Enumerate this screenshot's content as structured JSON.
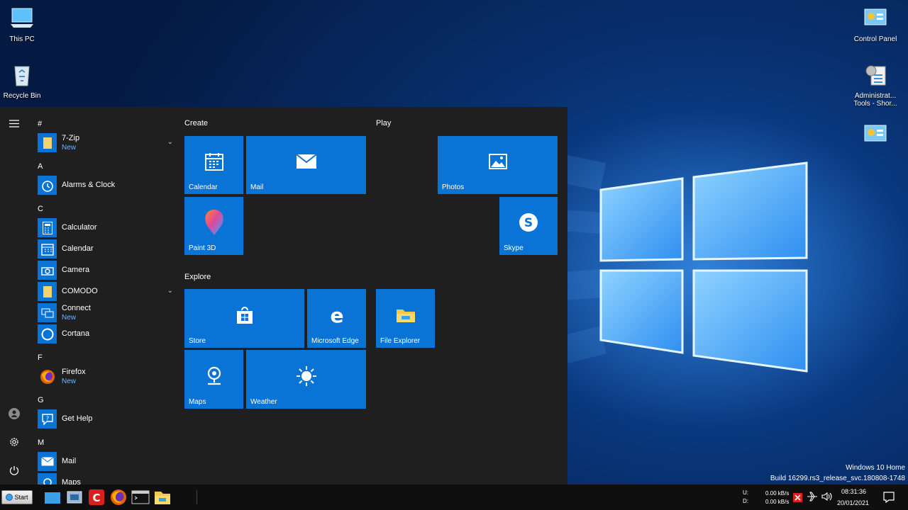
{
  "desktop": {
    "icons_left": [
      {
        "label": "This PC",
        "icon": "this-pc-icon"
      },
      {
        "label": "Recycle Bin",
        "icon": "recycle-bin-icon"
      }
    ],
    "icons_right": [
      {
        "label": "Control Panel",
        "icon": "control-panel-icon"
      },
      {
        "label": "Administrat...",
        "label2": "Tools - Shor...",
        "icon": "administrative-tools-icon"
      },
      {
        "label": "",
        "icon": "control-panel-icon"
      }
    ],
    "watermark": {
      "line1": "Windows 10 Home",
      "line2": "Build 16299.rs3_release_svc.180808-1748"
    }
  },
  "start_menu": {
    "rail": {
      "menu": "hamburger-icon",
      "user": "user-icon",
      "settings": "gear-icon",
      "power": "power-icon"
    },
    "letters": [
      "#",
      "A",
      "C",
      "F",
      "G",
      "M"
    ],
    "apps": [
      {
        "name": "7-Zip",
        "badge": "New",
        "icon": "folder-icon",
        "expand": "⌄"
      },
      {
        "name": "Alarms & Clock",
        "badge": "",
        "icon": "alarm-clock-icon"
      },
      {
        "name": "Calculator",
        "badge": "",
        "icon": "calculator-icon"
      },
      {
        "name": "Calendar",
        "badge": "",
        "icon": "calendar-icon"
      },
      {
        "name": "Camera",
        "badge": "",
        "icon": "camera-icon"
      },
      {
        "name": "COMODO",
        "badge": "",
        "icon": "folder-icon",
        "expand": "⌄"
      },
      {
        "name": "Connect",
        "badge": "New",
        "icon": "connect-icon"
      },
      {
        "name": "Cortana",
        "badge": "",
        "icon": "cortana-icon"
      },
      {
        "name": "Firefox",
        "badge": "New",
        "icon": "firefox-icon"
      },
      {
        "name": "Get Help",
        "badge": "",
        "icon": "help-icon"
      },
      {
        "name": "Mail",
        "badge": "",
        "icon": "mail-icon"
      },
      {
        "name": "Maps",
        "badge": "",
        "icon": "maps-icon"
      }
    ],
    "groups": {
      "create": "Create",
      "play": "Play",
      "explore": "Explore"
    },
    "tiles": {
      "calendar": "Calendar",
      "mail": "Mail",
      "paint3d": "Paint 3D",
      "photos": "Photos",
      "skype": "Skype",
      "store": "Store",
      "edge": "Microsoft Edge",
      "file_explorer": "File Explorer",
      "maps": "Maps",
      "weather": "Weather"
    }
  },
  "taskbar": {
    "start_label": "Start",
    "pinned": [
      "file-explorer-window-icon",
      "network-icon",
      "comodo-icon",
      "firefox-icon",
      "cmd-icon",
      "folder-icon"
    ],
    "net": {
      "up_label": "U:",
      "down_label": "D:",
      "up": "0.00 kB/s",
      "down": "0.00 kB/s"
    },
    "clock": {
      "time": "08:31:36",
      "date": "20/01/2021"
    }
  },
  "colors": {
    "tile": "#0a74d6",
    "menu_bg": "#1f1f1f",
    "accent_new": "#6fb4ff"
  }
}
